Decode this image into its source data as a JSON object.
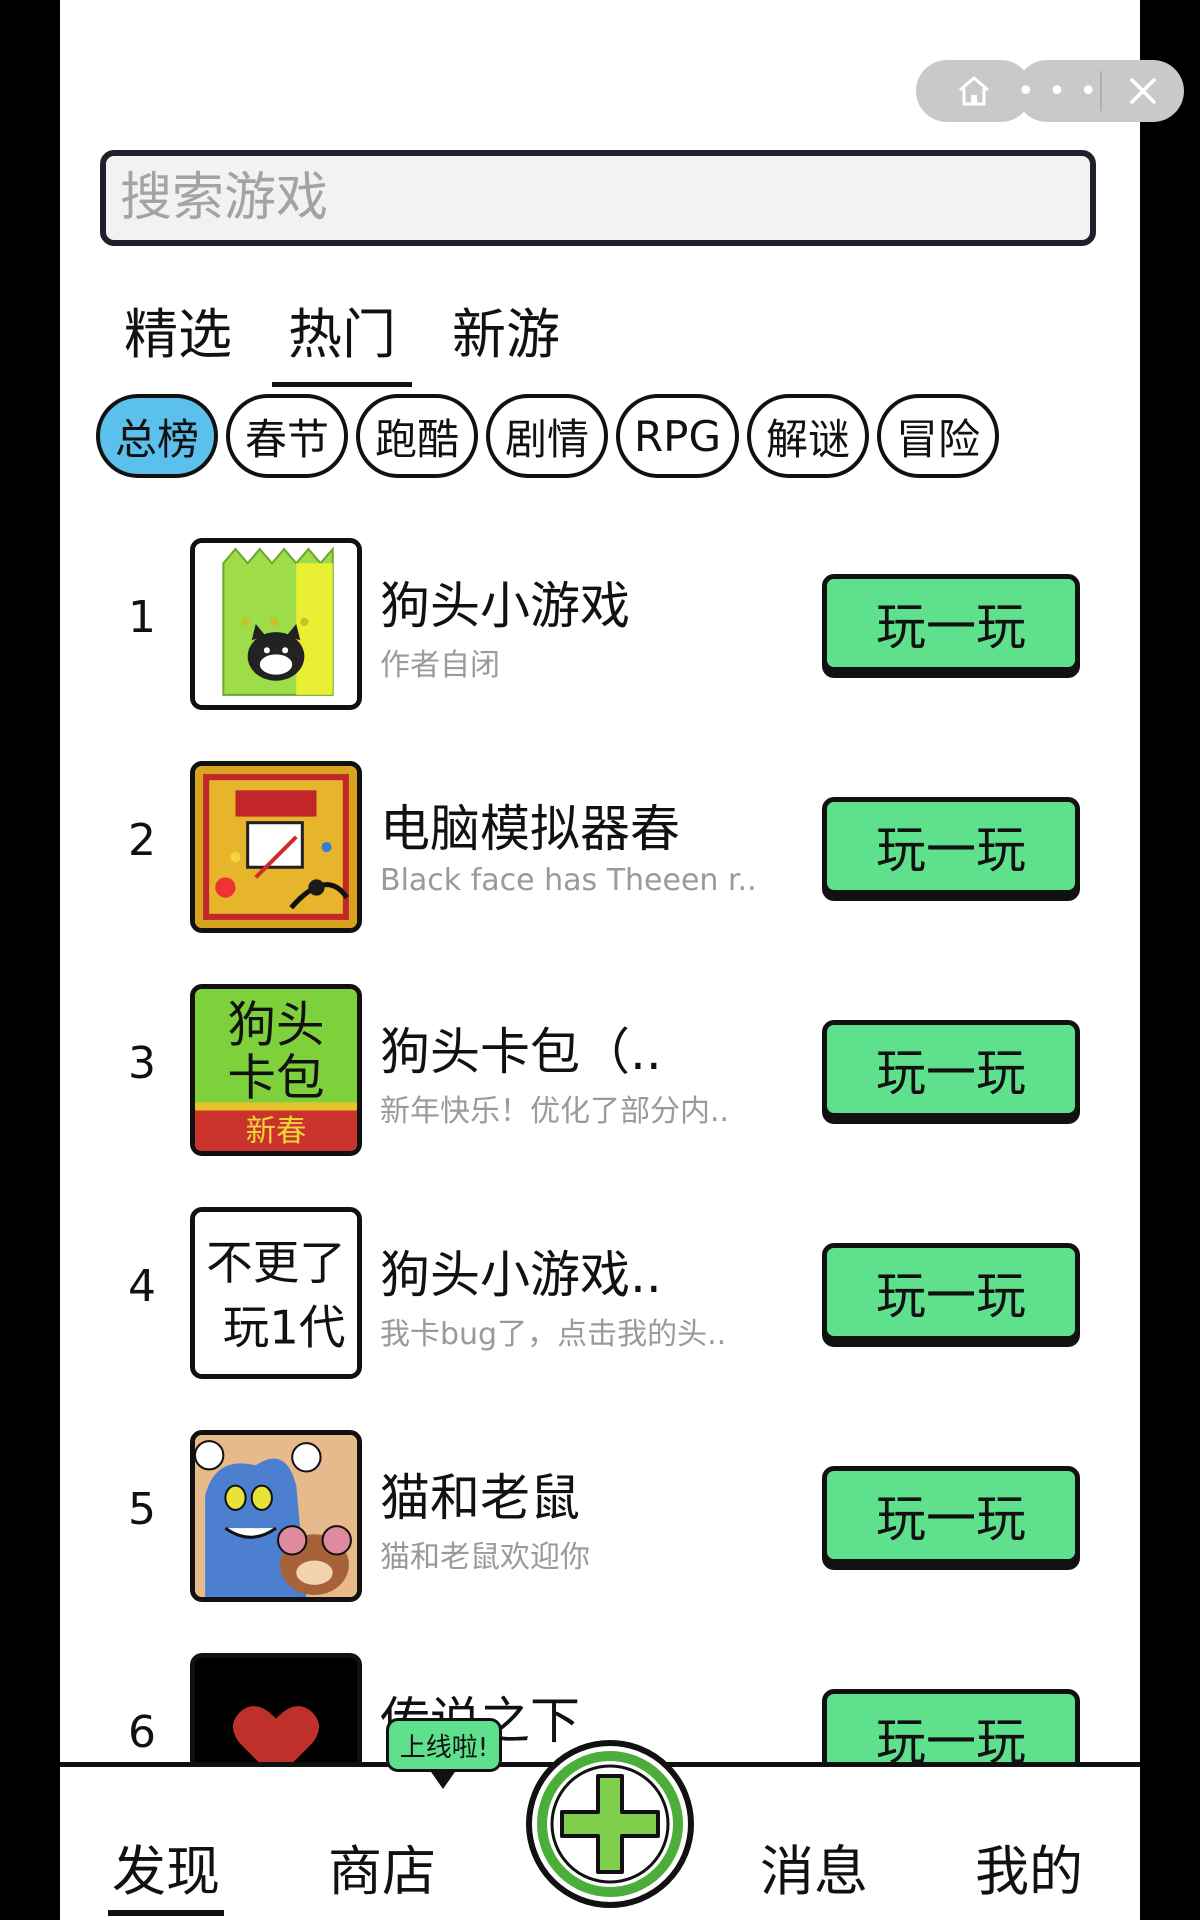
{
  "search": {
    "placeholder": "搜索游戏"
  },
  "tabs": [
    {
      "label": "精选"
    },
    {
      "label": "热门"
    },
    {
      "label": "新游"
    }
  ],
  "categories": [
    {
      "label": "总榜"
    },
    {
      "label": "春节"
    },
    {
      "label": "跑酷"
    },
    {
      "label": "剧情"
    },
    {
      "label": "RPG"
    },
    {
      "label": "解谜"
    },
    {
      "label": "冒险"
    }
  ],
  "games": [
    {
      "rank": "1",
      "title": "狗头小游戏",
      "desc": "作者自闭",
      "play_label": "玩一玩"
    },
    {
      "rank": "2",
      "title": "电脑模拟器春",
      "desc": "Black face has Theeen r..",
      "play_label": "玩一玩"
    },
    {
      "rank": "3",
      "title": "狗头卡包（..",
      "desc": "新年快乐！优化了部分内..",
      "play_label": "玩一玩"
    },
    {
      "rank": "4",
      "title": "狗头小游戏..",
      "desc": "我卡bug了，点击我的头..",
      "play_label": "玩一玩"
    },
    {
      "rank": "5",
      "title": "猫和老鼠",
      "desc": "猫和老鼠欢迎你",
      "play_label": "玩一玩"
    },
    {
      "rank": "6",
      "title": "传说之下",
      "desc": "",
      "play_label": "玩一玩"
    }
  ],
  "thumb_text": {
    "t3_top": "狗头",
    "t3_mid": "卡包",
    "t3_bottom": "新春",
    "t4_line1": "不更了",
    "t4_line2": "玩1代"
  },
  "nav": {
    "discover": "发现",
    "shop": "商店",
    "shop_badge": "上线啦!",
    "messages": "消息",
    "mine": "我的"
  },
  "colors": {
    "accent_green": "#5fe08c",
    "chip_active": "#5bc0eb"
  }
}
